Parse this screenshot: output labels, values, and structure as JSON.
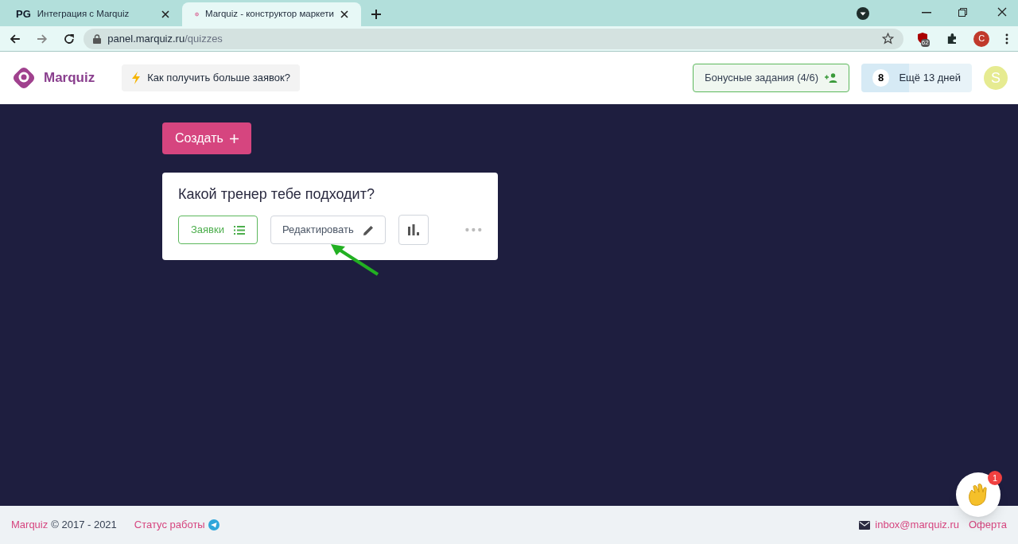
{
  "browser": {
    "tabs": [
      {
        "favicon_text": "PG",
        "title": "Интеграция с Marquiz",
        "selected": false
      },
      {
        "title": "Marquiz - конструктор маркети",
        "selected": true
      }
    ],
    "url_host": "panel.marquiz.ru",
    "url_path": "/quizzes",
    "extension_badge": "62",
    "profile_initial": "C"
  },
  "header": {
    "logo": "Marquiz",
    "tip": "Как получить больше заявок?",
    "bonus": "Бонусные задания (4/6)",
    "days_number": "8",
    "days_text": "Ещё 13 дней",
    "avatar": "S"
  },
  "create_button": "Создать",
  "quizzes": [
    {
      "title": "Какой тренер тебе подходит?",
      "requests": "Заявки",
      "edit": "Редактировать"
    }
  ],
  "footer": {
    "brand": "Marquiz",
    "copyright": "© 2017 - 2021",
    "status": "Статус работы",
    "email": "inbox@marquiz.ru",
    "offer": "Оферта"
  },
  "chat": {
    "badge": "1"
  }
}
